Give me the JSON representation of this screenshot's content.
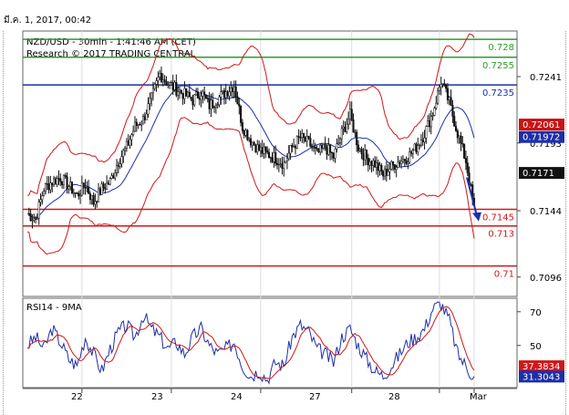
{
  "header": {
    "timestamp": "มี.ค. 1, 2017, 00:42"
  },
  "chart_data": {
    "type": "candlestick",
    "title": "NZD/USD - 30min - 1:41:46 AM (CET)",
    "subtitle": "Research © 2017 TRADING CENTRAL",
    "x_ticks": [
      "22",
      "23",
      "24",
      "27",
      "28",
      "Mar"
    ],
    "y_ticks": [
      0.7241,
      0.7193,
      0.7144,
      0.7096
    ],
    "ylim": [
      0.7082,
      0.7274
    ],
    "levels": [
      {
        "label": "0.728",
        "value": 0.7268,
        "color": "#2e9b2e"
      },
      {
        "label": "0.7255",
        "value": 0.7255,
        "color": "#2e9b2e"
      },
      {
        "label": "0.7235",
        "value": 0.7235,
        "color": "#1d2fa8"
      },
      {
        "label": "0.7145",
        "value": 0.7145,
        "color": "#d01818"
      },
      {
        "label": "0.713",
        "value": 0.7133,
        "color": "#d01818"
      },
      {
        "label": "0.71",
        "value": 0.7104,
        "color": "#d01818"
      }
    ],
    "markers": [
      {
        "label": "0.72061",
        "value": 0.7206,
        "color": "#c81414"
      },
      {
        "label": "0.71972",
        "value": 0.7197,
        "color": "#1d2fa8"
      },
      {
        "label": "0.7171",
        "value": 0.7171,
        "color": "#111111"
      }
    ],
    "price_anchors": [
      [
        0,
        0.7142
      ],
      [
        5,
        0.7138
      ],
      [
        10,
        0.716
      ],
      [
        15,
        0.7165
      ],
      [
        20,
        0.7168
      ],
      [
        25,
        0.7162
      ],
      [
        30,
        0.7155
      ],
      [
        35,
        0.7163
      ],
      [
        40,
        0.715
      ],
      [
        45,
        0.716
      ],
      [
        50,
        0.7165
      ],
      [
        55,
        0.718
      ],
      [
        60,
        0.719
      ],
      [
        65,
        0.7205
      ],
      [
        70,
        0.721
      ],
      [
        75,
        0.7225
      ],
      [
        80,
        0.7243
      ],
      [
        85,
        0.7236
      ],
      [
        90,
        0.7232
      ],
      [
        95,
        0.7228
      ],
      [
        100,
        0.7224
      ],
      [
        105,
        0.723
      ],
      [
        110,
        0.722
      ],
      [
        115,
        0.7225
      ],
      [
        120,
        0.723
      ],
      [
        125,
        0.7235
      ],
      [
        130,
        0.7205
      ],
      [
        135,
        0.7195
      ],
      [
        140,
        0.7188
      ],
      [
        145,
        0.7185
      ],
      [
        150,
        0.7182
      ],
      [
        155,
        0.7178
      ],
      [
        160,
        0.719
      ],
      [
        165,
        0.7197
      ],
      [
        170,
        0.7193
      ],
      [
        175,
        0.7185
      ],
      [
        180,
        0.719
      ],
      [
        185,
        0.7183
      ],
      [
        190,
        0.72
      ],
      [
        195,
        0.7213
      ],
      [
        200,
        0.719
      ],
      [
        205,
        0.7182
      ],
      [
        210,
        0.7178
      ],
      [
        215,
        0.717
      ],
      [
        220,
        0.7176
      ],
      [
        225,
        0.718
      ],
      [
        230,
        0.7183
      ],
      [
        235,
        0.719
      ],
      [
        240,
        0.72
      ],
      [
        245,
        0.7215
      ],
      [
        250,
        0.7238
      ],
      [
        255,
        0.7222
      ],
      [
        260,
        0.72
      ],
      [
        265,
        0.718
      ],
      [
        270,
        0.7145
      ]
    ],
    "forecast_arrow": {
      "from_value": 0.7168,
      "to_value": 0.7137
    },
    "rsi": {
      "label": "RSI14 - 9MA",
      "y_ticks": [
        70,
        50
      ],
      "ylim": [
        25,
        78
      ],
      "markers": [
        {
          "label": "37.3834",
          "value": 37.4,
          "color": "#d01818"
        },
        {
          "label": "31.3043",
          "value": 31.3,
          "color": "#1d2fa8"
        }
      ],
      "anchors": [
        [
          0,
          50
        ],
        [
          5,
          55
        ],
        [
          10,
          48
        ],
        [
          15,
          60
        ],
        [
          20,
          52
        ],
        [
          25,
          42
        ],
        [
          30,
          38
        ],
        [
          35,
          55
        ],
        [
          40,
          45
        ],
        [
          45,
          35
        ],
        [
          50,
          48
        ],
        [
          55,
          58
        ],
        [
          60,
          62
        ],
        [
          65,
          55
        ],
        [
          70,
          68
        ],
        [
          75,
          60
        ],
        [
          80,
          55
        ],
        [
          85,
          48
        ],
        [
          90,
          52
        ],
        [
          95,
          45
        ],
        [
          100,
          55
        ],
        [
          105,
          60
        ],
        [
          110,
          50
        ],
        [
          115,
          45
        ],
        [
          120,
          48
        ],
        [
          125,
          52
        ],
        [
          130,
          38
        ],
        [
          135,
          32
        ],
        [
          140,
          35
        ],
        [
          145,
          30
        ],
        [
          150,
          40
        ],
        [
          155,
          38
        ],
        [
          160,
          55
        ],
        [
          165,
          62
        ],
        [
          170,
          58
        ],
        [
          175,
          48
        ],
        [
          180,
          45
        ],
        [
          185,
          40
        ],
        [
          190,
          55
        ],
        [
          195,
          60
        ],
        [
          200,
          50
        ],
        [
          205,
          42
        ],
        [
          210,
          35
        ],
        [
          215,
          32
        ],
        [
          220,
          38
        ],
        [
          225,
          45
        ],
        [
          230,
          52
        ],
        [
          235,
          55
        ],
        [
          240,
          60
        ],
        [
          245,
          72
        ],
        [
          250,
          75
        ],
        [
          255,
          65
        ],
        [
          260,
          45
        ],
        [
          265,
          38
        ],
        [
          270,
          31
        ]
      ]
    }
  }
}
